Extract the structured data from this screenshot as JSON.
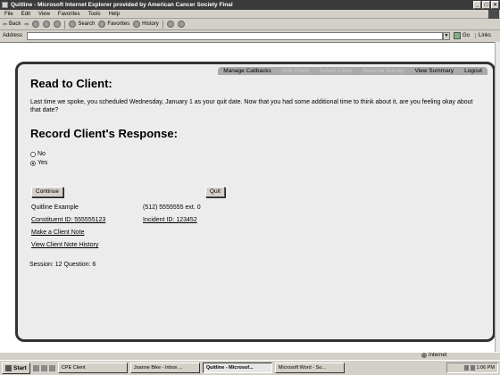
{
  "window": {
    "title": "Quitline - Microsoft Internet Explorer provided by American Cancer Society Final",
    "controls": [
      "_",
      "□",
      "×"
    ]
  },
  "menu": [
    "File",
    "Edit",
    "View",
    "Favorites",
    "Tools",
    "Help"
  ],
  "toolbar": {
    "back": "Back",
    "search": "Search",
    "favorites": "Favorites",
    "history": "History"
  },
  "address": {
    "label": "Address",
    "value": "",
    "go": "Go",
    "links": "Links"
  },
  "nav": {
    "manage_callbacks": "Manage Callbacks",
    "add_client": "Add Client",
    "select_client": "Select Client",
    "resume_survey": "Resume Survey",
    "view_summary": "View Summary",
    "logout": "Logout"
  },
  "read_heading": "Read to Client:",
  "script_text": "Last time we spoke, you scheduled Wednesday, January 1 as your quit date. Now that you had some additional time to think about it, are you feeling okay about that date?",
  "record_heading": "Record Client's Response:",
  "options": {
    "no": "No",
    "yes": "Yes",
    "selected": "Yes"
  },
  "buttons": {
    "continue": "Continue",
    "quit": "Quit"
  },
  "client": {
    "name": "Quitline Example",
    "phone": "(512) 5555555 ext. 0",
    "constituent_id": "Constituent ID: 555555123",
    "incident_id": "Incident ID: 123452",
    "make_note": "Make a Client Note",
    "view_history": "View Client Note History",
    "session": "Session: 12 Question: 6"
  },
  "status": {
    "left": "",
    "zone": "Internet"
  },
  "taskbar": {
    "start": "Start",
    "tasks": [
      "CPE Client",
      "Joanne Bike - Inbox ...",
      "Quitline - Microsof...",
      "Microsoft Word - So..."
    ],
    "active_task": "Quitline - Microsof...",
    "clock": "1:06 PM"
  }
}
